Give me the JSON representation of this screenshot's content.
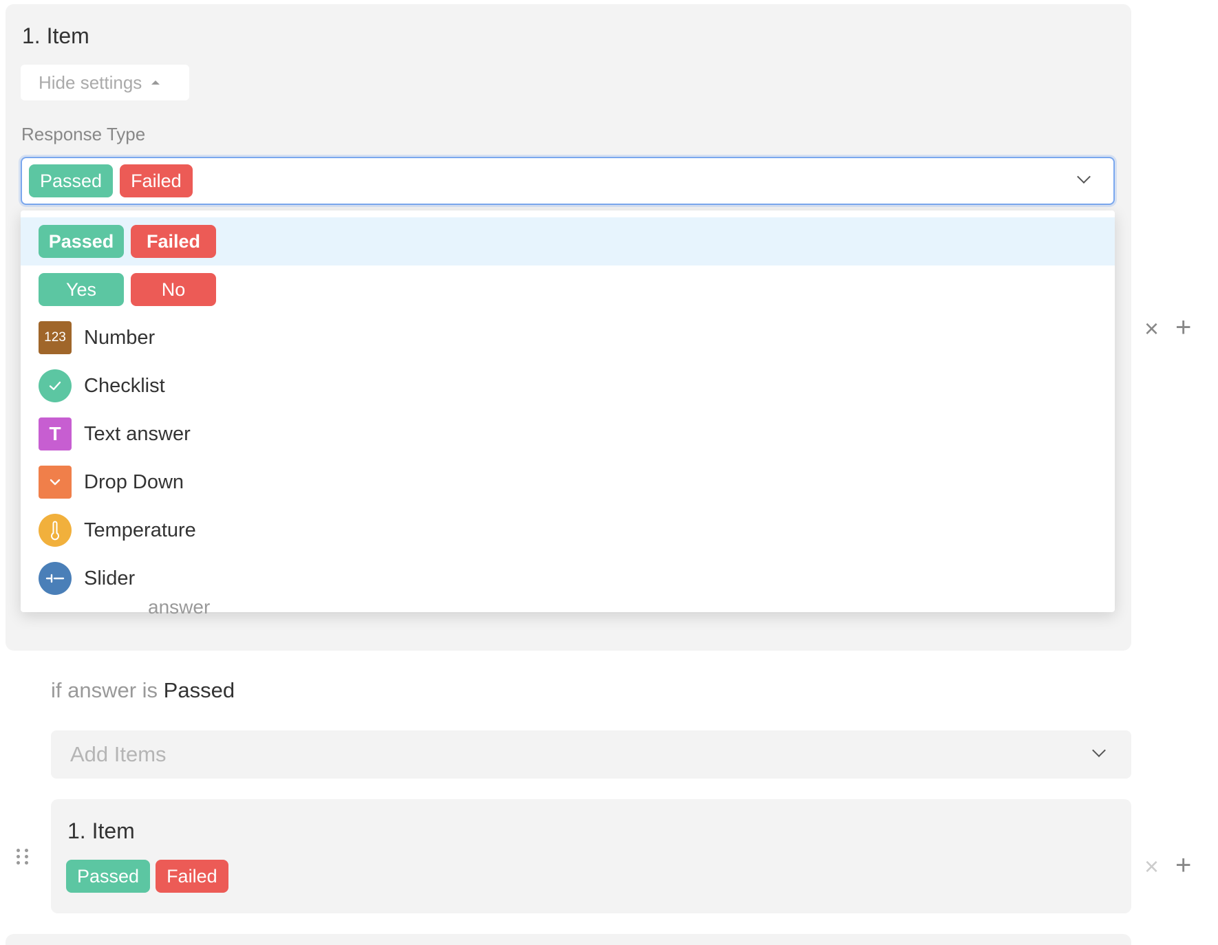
{
  "top_item": {
    "title": "1. Item",
    "hide_settings": "Hide settings",
    "response_type_label": "Response Type",
    "selected": {
      "positive": "Passed",
      "negative": "Failed"
    }
  },
  "dropdown": {
    "pair_options": [
      {
        "positive": "Passed",
        "negative": "Failed"
      },
      {
        "positive": "Yes",
        "negative": "No"
      }
    ],
    "options": [
      {
        "label": "Number",
        "icon": "number-icon",
        "icon_text": "123"
      },
      {
        "label": "Checklist",
        "icon": "checkmark-icon"
      },
      {
        "label": "Text answer",
        "icon": "text-icon",
        "icon_text": "T"
      },
      {
        "label": "Drop Down",
        "icon": "chevron-down-icon"
      },
      {
        "label": "Temperature",
        "icon": "thermometer-icon"
      },
      {
        "label": "Slider",
        "icon": "slider-icon"
      }
    ]
  },
  "peek_text": "answer",
  "logic": {
    "prefix": "if answer is",
    "value": "Passed"
  },
  "add_items": {
    "placeholder": "Add Items"
  },
  "sub_item": {
    "title": "1. Item",
    "positive": "Passed",
    "negative": "Failed"
  },
  "side_actions": {
    "remove": "×",
    "add": "+"
  },
  "colors": {
    "positive": "#5cc6a2",
    "negative": "#ec5b56",
    "focus_border": "#7aa7ee",
    "highlight_row": "#e7f4fd"
  }
}
